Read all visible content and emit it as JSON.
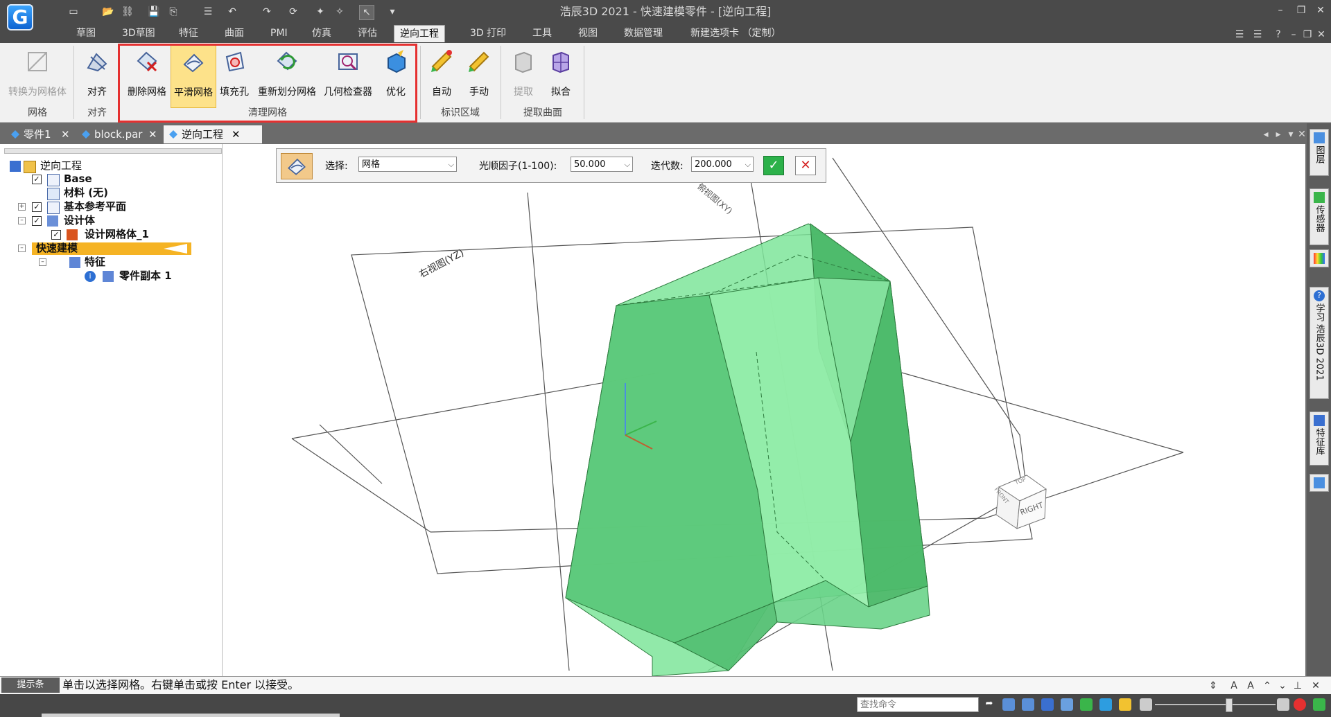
{
  "window": {
    "title": "浩辰3D 2021 - 快速建模零件 - [逆向工程]"
  },
  "menu_tabs": [
    "草图",
    "3D草图",
    "特征",
    "曲面",
    "PMI",
    "仿真",
    "评估",
    "逆向工程",
    "3D 打印",
    "工具",
    "视图",
    "数据管理",
    "新建选项卡 （定制）"
  ],
  "active_menu_tab": "逆向工程",
  "ribbon": {
    "groups": [
      {
        "name": "网格",
        "buttons": [
          {
            "label": "转换为网格体",
            "enabled": false
          }
        ]
      },
      {
        "name": "对齐",
        "buttons": [
          {
            "label": "对齐",
            "enabled": true
          }
        ]
      },
      {
        "name": "清理网格",
        "buttons": [
          {
            "label": "删除网格",
            "enabled": true
          },
          {
            "label": "平滑网格",
            "enabled": true,
            "highlighted": true
          },
          {
            "label": "填充孔",
            "enabled": true
          },
          {
            "label": "重新划分网格",
            "enabled": true
          },
          {
            "label": "几何检查器",
            "enabled": true
          },
          {
            "label": "优化",
            "enabled": true
          }
        ]
      },
      {
        "name": "标识区域",
        "buttons": [
          {
            "label": "自动",
            "enabled": true
          },
          {
            "label": "手动",
            "enabled": true
          }
        ]
      },
      {
        "name": "提取曲面",
        "buttons": [
          {
            "label": "提取",
            "enabled": false
          },
          {
            "label": "拟合",
            "enabled": true
          }
        ]
      }
    ]
  },
  "doc_tabs": [
    {
      "label": "零件1",
      "active": false
    },
    {
      "label": "block.par",
      "active": false
    },
    {
      "label": "逆向工程",
      "active": true
    }
  ],
  "tree": {
    "nodes": [
      {
        "label": "逆向工程",
        "level": 0
      },
      {
        "label": "Base",
        "level": 1,
        "checked": true
      },
      {
        "label": "材料 (无)",
        "level": 1
      },
      {
        "label": "基本参考平面",
        "level": 1,
        "checked": true
      },
      {
        "label": "设计体",
        "level": 1,
        "checked": true
      },
      {
        "label": "设计网格体_1",
        "level": 2,
        "checked": true
      },
      {
        "label": "快速建模",
        "level": 0,
        "selected": true
      },
      {
        "label": "特征",
        "level": 1
      },
      {
        "label": "零件副本 1",
        "level": 2
      }
    ]
  },
  "command_bar": {
    "select_label": "选择:",
    "select_value": "网格",
    "smooth_label": "光顺因子(1-100):",
    "smooth_value": "50.000",
    "iter_label": "迭代数:",
    "iter_value": "200.000"
  },
  "viewport": {
    "plane_right": "右视图(YZ)",
    "plane_top": "俯视图(XY)",
    "viewcube_right": "RIGHT",
    "viewcube_front": "FRONT",
    "viewcube_top": "TOP",
    "mesh_color": "#7ee59a"
  },
  "right_dock": [
    "图层",
    "传感器",
    "学习 浩辰3D 2021",
    "特征库"
  ],
  "prompt": {
    "label": "提示条",
    "text": "单击以选择网格。右键单击或按 Enter 以接受。"
  },
  "status": {
    "search_placeholder": "查找命令"
  },
  "colors": {
    "accent_red": "#e53030",
    "highlight": "#fde28a",
    "chrome_dark": "#4a4a4a"
  }
}
